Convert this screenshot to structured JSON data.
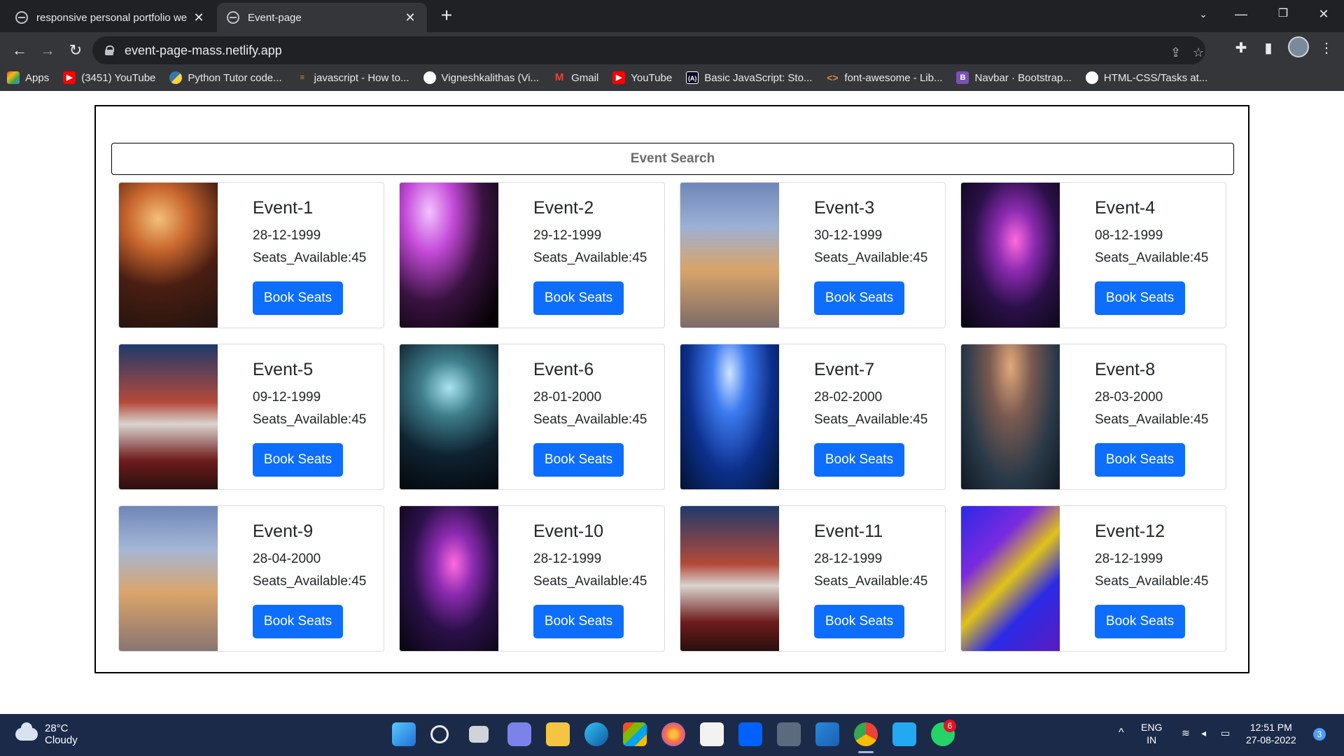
{
  "browser": {
    "tabs": [
      {
        "title": "responsive personal portfolio we",
        "active": false
      },
      {
        "title": "Event-page",
        "active": true
      }
    ],
    "url": "event-page-mass.netlify.app",
    "bookmarks": [
      {
        "label": "Apps",
        "icon": "apps-grid-icon",
        "color": "#f4b400"
      },
      {
        "label": "(3451) YouTube",
        "icon": "youtube-icon",
        "color": "#ff0000"
      },
      {
        "label": "Python Tutor code...",
        "icon": "python-icon",
        "color": "#3776ab"
      },
      {
        "label": "javascript - How to...",
        "icon": "stackoverflow-icon",
        "color": "#f48024"
      },
      {
        "label": "Vigneshkalithas (Vi...",
        "icon": "github-icon",
        "color": "#ffffff"
      },
      {
        "label": "Gmail",
        "icon": "gmail-icon",
        "color": "#ea4335"
      },
      {
        "label": "YouTube",
        "icon": "youtube-icon",
        "color": "#ff0000"
      },
      {
        "label": "Basic JavaScript: Sto...",
        "icon": "freecodecamp-icon",
        "color": "#0a0a23"
      },
      {
        "label": "font-awesome - Lib...",
        "icon": "code-brackets-icon",
        "color": "#e8833a"
      },
      {
        "label": "Navbar · Bootstrap...",
        "icon": "bootstrap-icon",
        "color": "#7952b3"
      },
      {
        "label": "HTML-CSS/Tasks at...",
        "icon": "github-icon",
        "color": "#ffffff"
      }
    ]
  },
  "page": {
    "search_placeholder": "Event Search",
    "book_label": "Book Seats",
    "accent_color": "#0d6efd",
    "events": [
      {
        "title": "Event-1",
        "date": "28-12-1999",
        "seats": "Seats_Available:45"
      },
      {
        "title": "Event-2",
        "date": "29-12-1999",
        "seats": "Seats_Available:45"
      },
      {
        "title": "Event-3",
        "date": "30-12-1999",
        "seats": "Seats_Available:45"
      },
      {
        "title": "Event-4",
        "date": "08-12-1999",
        "seats": "Seats_Available:45"
      },
      {
        "title": "Event-5",
        "date": "09-12-1999",
        "seats": "Seats_Available:45"
      },
      {
        "title": "Event-6",
        "date": "28-01-2000",
        "seats": "Seats_Available:45"
      },
      {
        "title": "Event-7",
        "date": "28-02-2000",
        "seats": "Seats_Available:45"
      },
      {
        "title": "Event-8",
        "date": "28-03-2000",
        "seats": "Seats_Available:45"
      },
      {
        "title": "Event-9",
        "date": "28-04-2000",
        "seats": "Seats_Available:45"
      },
      {
        "title": "Event-10",
        "date": "28-12-1999",
        "seats": "Seats_Available:45"
      },
      {
        "title": "Event-11",
        "date": "28-12-1999",
        "seats": "Seats_Available:45"
      },
      {
        "title": "Event-12",
        "date": "28-12-1999",
        "seats": "Seats_Available:45"
      }
    ]
  },
  "taskbar": {
    "weather_temp": "28°C",
    "weather_desc": "Cloudy",
    "lang_top": "ENG",
    "lang_bottom": "IN",
    "time": "12:51 PM",
    "date": "27-08-2022",
    "whatsapp_badge": "6",
    "notification_count": "3"
  }
}
